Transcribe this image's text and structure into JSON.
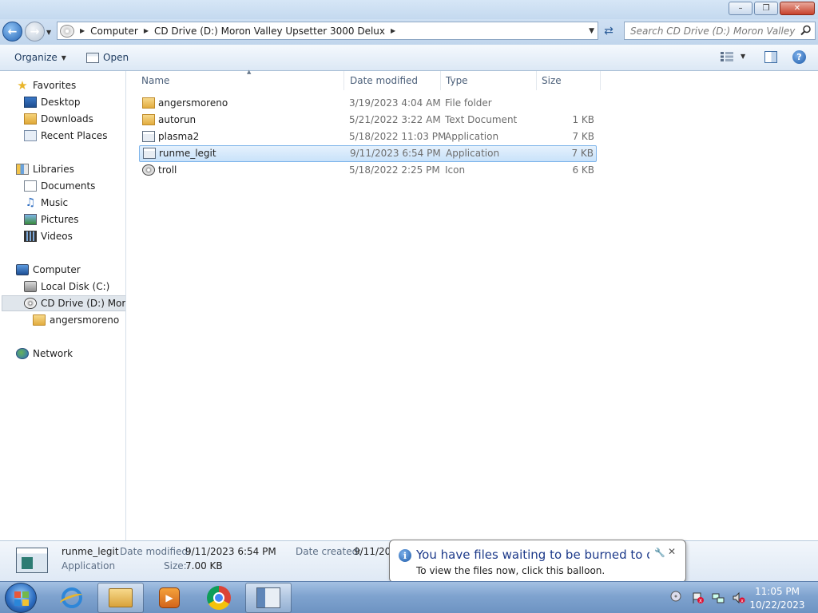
{
  "window": {
    "minimize_glyph": "–",
    "maximize_glyph": "❐",
    "close_glyph": "✕"
  },
  "address": {
    "crumbs": [
      "Computer",
      "CD Drive (D:) Moron Valley Upsetter 3000 Delux"
    ],
    "search_placeholder": "Search CD Drive (D:) Moron Valley Up..."
  },
  "toolbar": {
    "organize_label": "Organize",
    "open_label": "Open",
    "help_glyph": "?"
  },
  "nav": {
    "favorites": "Favorites",
    "desktop": "Desktop",
    "downloads": "Downloads",
    "recent_places": "Recent Places",
    "libraries": "Libraries",
    "documents": "Documents",
    "music": "Music",
    "pictures": "Pictures",
    "videos": "Videos",
    "computer": "Computer",
    "local_disk": "Local Disk (C:)",
    "cd_drive": "CD Drive (D:) Moron",
    "angersmoreno": "angersmoreno",
    "network": "Network"
  },
  "columns": {
    "name": "Name",
    "date_modified": "Date modified",
    "type": "Type",
    "size": "Size"
  },
  "files": [
    {
      "name": "angersmoreno",
      "date": "3/19/2023 4:04 AM",
      "type": "File folder",
      "size": "",
      "icon": "folder-icon"
    },
    {
      "name": "autorun",
      "date": "5/21/2022 3:22 AM",
      "type": "Text Document",
      "size": "1 KB",
      "icon": "folder-icon"
    },
    {
      "name": "plasma2",
      "date": "5/18/2022 11:03 PM",
      "type": "Application",
      "size": "7 KB",
      "icon": "application-icon"
    },
    {
      "name": "runme_legit",
      "date": "9/11/2023 6:54 PM",
      "type": "Application",
      "size": "7 KB",
      "icon": "application-icon",
      "selected": true
    },
    {
      "name": "troll",
      "date": "5/18/2022 2:25 PM",
      "type": "Icon",
      "size": "6 KB",
      "icon": "icon-file-icon"
    }
  ],
  "details": {
    "name": "runme_legit",
    "type": "Application",
    "date_modified_label": "Date modified:",
    "date_modified": "9/11/2023 6:54 PM",
    "size_label": "Size:",
    "size": "7.00 KB",
    "date_created_label": "Date created:",
    "date_created": "9/11/20"
  },
  "balloon": {
    "title": "You have files waiting to be burned to disc",
    "body": "To view the files now, click this balloon.",
    "info_glyph": "i",
    "close_glyph": "✕"
  },
  "taskbar": {
    "media_glyph": "▶",
    "time": "11:05 PM",
    "date": "10/22/2023"
  }
}
